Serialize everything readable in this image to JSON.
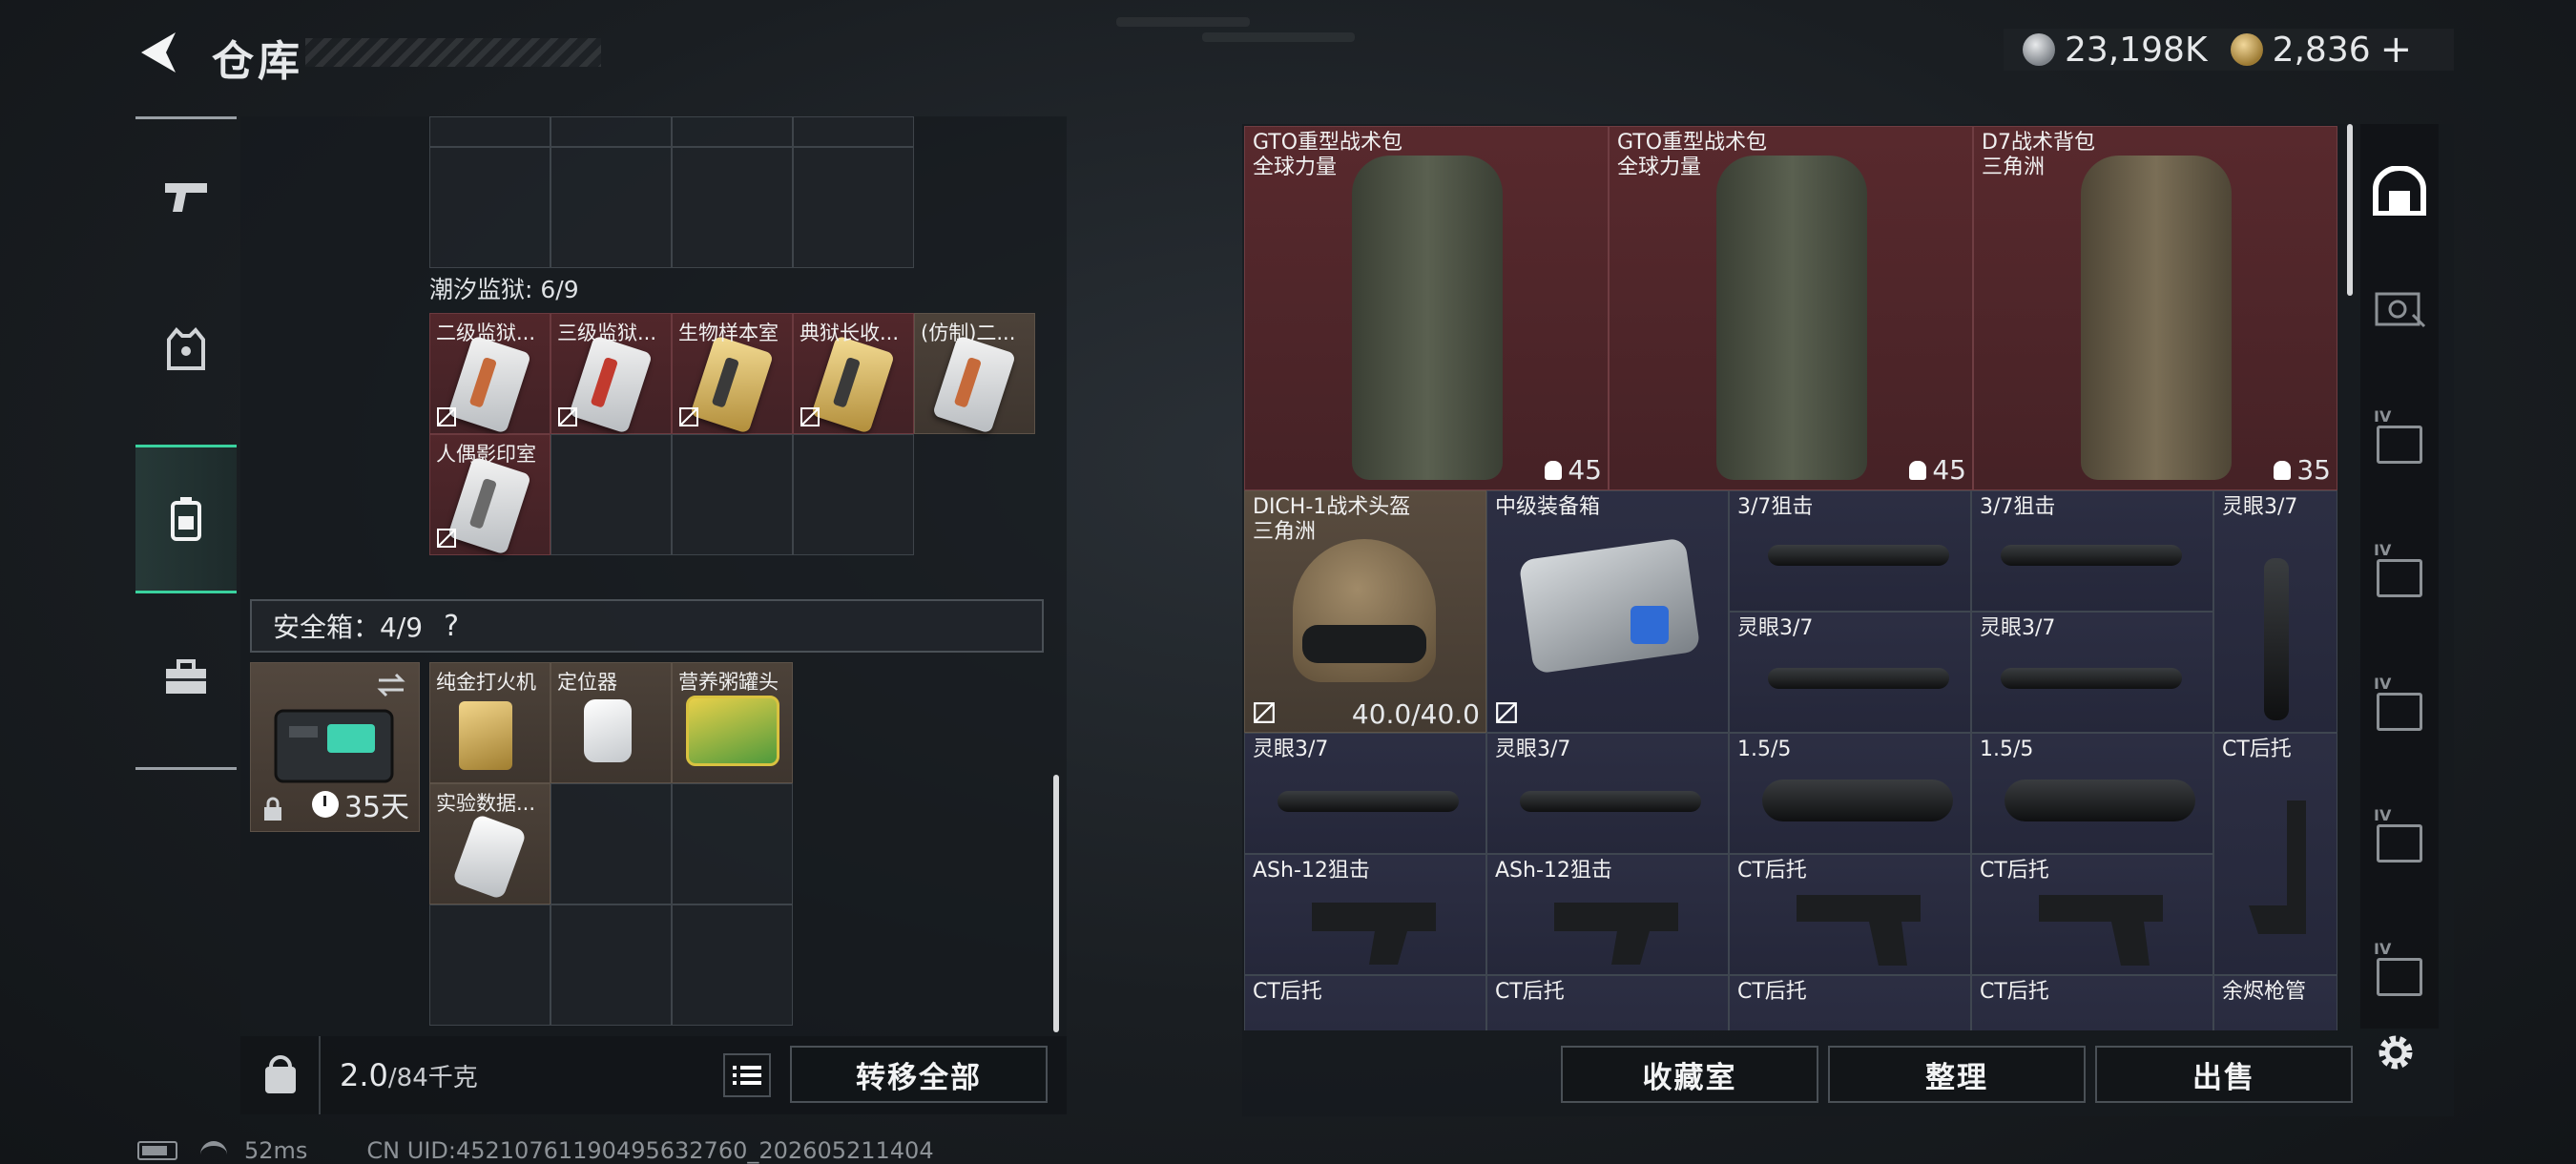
{
  "header": {
    "title": "仓库"
  },
  "currency": {
    "silver": "23,198K",
    "gold": "2,836",
    "add_label": "+"
  },
  "left_nav": {
    "items": [
      "weapons",
      "armor",
      "backpack",
      "toolbox"
    ],
    "active": "backpack"
  },
  "warehouse": {
    "section_title": "潮汐监狱: 6/9",
    "cards": [
      {
        "label": "二级监狱...",
        "color": "red",
        "card": "silver",
        "stripe": "#c66a3a"
      },
      {
        "label": "三级监狱...",
        "color": "red",
        "card": "silver",
        "stripe": "#c23a2e"
      },
      {
        "label": "生物样本室",
        "color": "red",
        "card": "gold",
        "stripe": "#3a3a3a"
      },
      {
        "label": "典狱长收...",
        "color": "red",
        "card": "gold",
        "stripe": "#3a3a3a"
      },
      {
        "label": "(仿制)二...",
        "color": "brown",
        "card": "silver",
        "stripe": "#c66a3a"
      },
      {
        "label": "人偶影印室",
        "color": "red",
        "card": "silver",
        "stripe": "#6a6a6a"
      }
    ]
  },
  "safebox": {
    "title": "安全箱：4/9",
    "help": "?",
    "timer": "35天",
    "items": [
      {
        "label": "纯金打火机"
      },
      {
        "label": "定位器"
      },
      {
        "label": "营养粥罐头"
      },
      {
        "label": "实验数据..."
      }
    ]
  },
  "bottom": {
    "weight_current": "2.0",
    "weight_max": "/84千克",
    "transfer_all": "转移全部"
  },
  "stash": {
    "items": [
      {
        "label": "GTO重型战术包",
        "sub": "全球力量",
        "count": "45",
        "color": "red",
        "tint": "#4c5142"
      },
      {
        "label": "GTO重型战术包",
        "sub": "全球力量",
        "count": "45",
        "color": "red",
        "tint": "#4c5142"
      },
      {
        "label": "D7战术背包",
        "sub": "三角洲",
        "count": "35",
        "color": "red",
        "tint": "#6a604c"
      },
      {
        "label": "DICH-1战术头盔",
        "sub": "三角洲",
        "durability": "40.0/40.0",
        "color": "brown"
      },
      {
        "label": "中级装备箱",
        "color": "blue"
      },
      {
        "label": "3/7狙击",
        "color": "blue"
      },
      {
        "label": "3/7狙击",
        "color": "blue"
      },
      {
        "label": "灵眼3/7",
        "color": "blue"
      },
      {
        "label": "灵眼3/7",
        "color": "blue"
      },
      {
        "label": "灵眼3/7",
        "color": "blue"
      },
      {
        "label": "灵眼3/7",
        "color": "blue"
      },
      {
        "label": "灵眼3/7",
        "color": "blue"
      },
      {
        "label": "1.5/5",
        "color": "blue"
      },
      {
        "label": "1.5/5",
        "color": "blue"
      },
      {
        "label": "CT后托",
        "color": "blue"
      },
      {
        "label": "ASh-12狙击",
        "color": "blue"
      },
      {
        "label": "ASh-12狙击",
        "color": "blue"
      },
      {
        "label": "CT后托",
        "color": "blue"
      },
      {
        "label": "CT后托",
        "color": "blue"
      },
      {
        "label": "CT后托",
        "color": "blue"
      },
      {
        "label": "CT后托",
        "color": "blue"
      },
      {
        "label": "CT后托",
        "color": "blue"
      },
      {
        "label": "CT后托",
        "color": "blue"
      },
      {
        "label": "余烬枪管",
        "color": "blue"
      }
    ]
  },
  "actions": {
    "collection": "收藏室",
    "sort": "整理",
    "sell": "出售"
  },
  "footer": {
    "ping": "52ms",
    "uid": "CN UID:45210761190495632760_202605211404"
  },
  "colors": {
    "accent": "#3ad29f",
    "red_cell": "#5c2a2e",
    "blue_cell": "#2e3046",
    "brown_cell": "#5c4e40"
  }
}
